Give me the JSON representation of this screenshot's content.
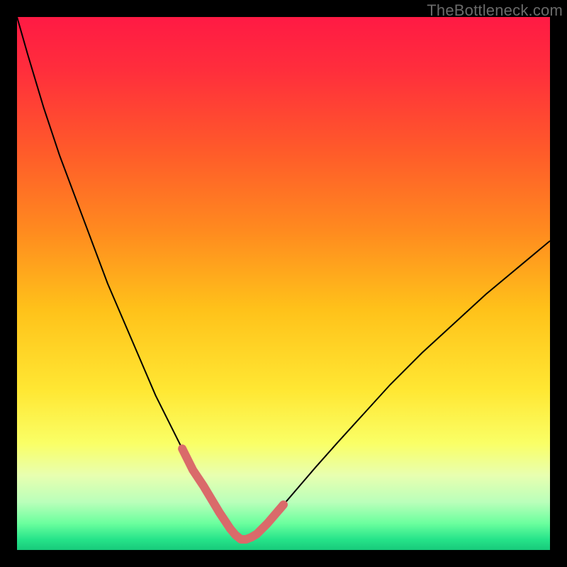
{
  "attribution": "TheBottleneck.com",
  "chart_data": {
    "type": "line",
    "title": "",
    "xlabel": "",
    "ylabel": "",
    "xlim": [
      0,
      100
    ],
    "ylim": [
      0,
      100
    ],
    "background_gradient": {
      "stops": [
        {
          "offset": 0.0,
          "color": "#ff1a44"
        },
        {
          "offset": 0.1,
          "color": "#ff2e3c"
        },
        {
          "offset": 0.25,
          "color": "#ff5a2a"
        },
        {
          "offset": 0.4,
          "color": "#ff8a1f"
        },
        {
          "offset": 0.55,
          "color": "#ffc21a"
        },
        {
          "offset": 0.7,
          "color": "#ffe733"
        },
        {
          "offset": 0.8,
          "color": "#faff66"
        },
        {
          "offset": 0.86,
          "color": "#e8ffb0"
        },
        {
          "offset": 0.91,
          "color": "#baffba"
        },
        {
          "offset": 0.95,
          "color": "#6bff9e"
        },
        {
          "offset": 0.98,
          "color": "#26e48a"
        },
        {
          "offset": 1.0,
          "color": "#18c97a"
        }
      ]
    },
    "series": [
      {
        "name": "curve",
        "stroke": "#000000",
        "stroke_width": 2,
        "x": [
          0,
          2,
          5,
          8,
          11,
          14,
          17,
          20,
          23,
          26,
          29,
          31,
          33,
          35,
          36.5,
          38,
          39,
          40,
          41,
          42,
          43,
          44,
          45,
          47,
          50,
          53,
          56,
          60,
          65,
          70,
          76,
          82,
          88,
          94,
          100
        ],
        "y": [
          100,
          93,
          83,
          74,
          66,
          58,
          50,
          43,
          36,
          29,
          23,
          19,
          15,
          12,
          9.5,
          7,
          5.5,
          4,
          2.8,
          2,
          2,
          2.4,
          3,
          5,
          8.5,
          12,
          15.5,
          20,
          25.5,
          31,
          37,
          42.5,
          48,
          53,
          58
        ]
      },
      {
        "name": "highlight-left",
        "stroke": "#da6a6a",
        "stroke_width": 12,
        "linecap": "round",
        "x": [
          31,
          33,
          35,
          36.5,
          38,
          39,
          40
        ],
        "y": [
          19,
          15,
          12,
          9.5,
          7,
          5.5,
          4
        ]
      },
      {
        "name": "highlight-bottom",
        "stroke": "#da6a6a",
        "stroke_width": 12,
        "linecap": "round",
        "x": [
          40,
          41,
          42,
          43,
          44
        ],
        "y": [
          4,
          2.8,
          2,
          2,
          2.4
        ]
      },
      {
        "name": "highlight-right",
        "stroke": "#da6a6a",
        "stroke_width": 12,
        "linecap": "round",
        "x": [
          44,
          45,
          47,
          50
        ],
        "y": [
          2.4,
          3,
          5,
          8.5
        ]
      }
    ]
  }
}
